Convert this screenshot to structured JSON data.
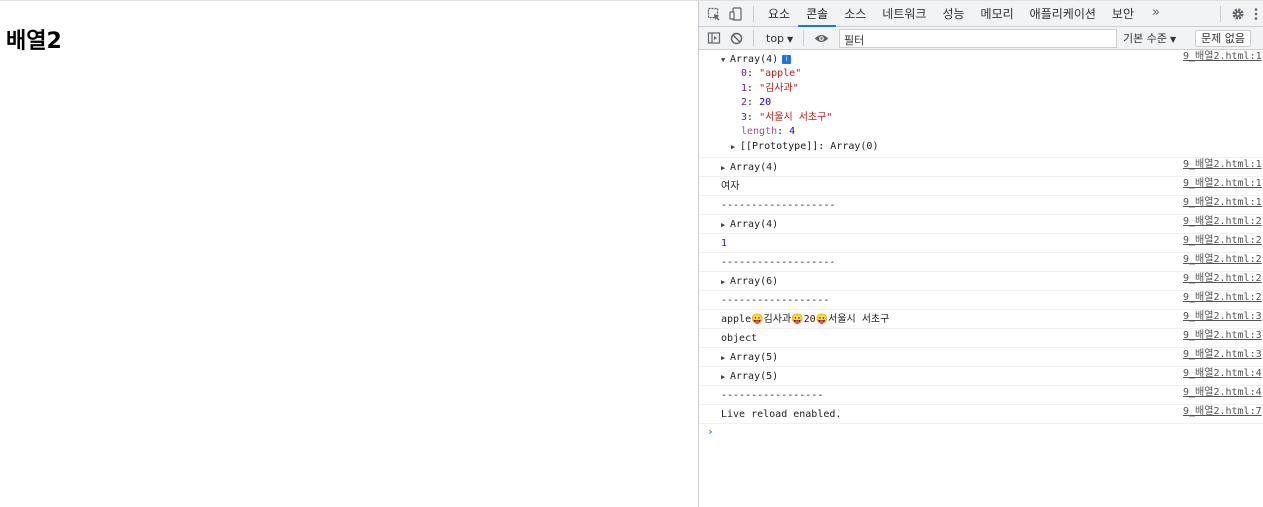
{
  "page": {
    "heading": "배열2"
  },
  "devtools": {
    "tabs": [
      "요소",
      "콘솔",
      "소스",
      "네트워크",
      "성능",
      "메모리",
      "애플리케이션",
      "보안"
    ],
    "active_tab": "콘솔",
    "more_tabs": "»",
    "toolbar": {
      "context": "top",
      "filter_placeholder": "필터",
      "level": "기본 수준",
      "issues": "문제 없음"
    },
    "expanded_array": {
      "header": "Array(4)",
      "items": [
        {
          "key": "0",
          "value": "\"apple\"",
          "kind": "str"
        },
        {
          "key": "1",
          "value": "\"김사과\"",
          "kind": "str"
        },
        {
          "key": "2",
          "value": "20",
          "kind": "num"
        },
        {
          "key": "3",
          "value": "\"서울시 서초구\"",
          "kind": "str"
        }
      ],
      "length_key": "length",
      "length_value": "4",
      "prototype": "[[Prototype]]: Array(0)",
      "source": "9_배열2.html:1"
    },
    "logs": [
      {
        "text": "Array(4)",
        "expandable": true,
        "source": "9_배열2.html:1"
      },
      {
        "text": "여자",
        "expandable": false,
        "source": "9_배열2.html:1"
      },
      {
        "text": "-------------------",
        "expandable": false,
        "source": "9_배열2.html:1"
      },
      {
        "text": "Array(4)",
        "expandable": true,
        "source": "9_배열2.html:2"
      },
      {
        "text": "1",
        "expandable": false,
        "number": true,
        "source": "9_배열2.html:2"
      },
      {
        "text": "-------------------",
        "expandable": false,
        "source": "9_배열2.html:2"
      },
      {
        "text": "Array(6)",
        "expandable": true,
        "source": "9_배열2.html:2"
      },
      {
        "text": "------------------",
        "expandable": false,
        "source": "9_배열2.html:2"
      },
      {
        "text": "apple😛김사과😛20😛서울시 서초구",
        "expandable": false,
        "source": "9_배열2.html:3"
      },
      {
        "text": "object",
        "expandable": false,
        "source": "9_배열2.html:3"
      },
      {
        "text": "Array(5)",
        "expandable": true,
        "source": "9_배열2.html:3"
      },
      {
        "text": "Array(5)",
        "expandable": true,
        "source": "9_배열2.html:4"
      },
      {
        "text": "-----------------",
        "expandable": false,
        "source": "9_배열2.html:4"
      },
      {
        "text": "Live reload enabled.",
        "expandable": false,
        "source": "9_배열2.html:7"
      }
    ],
    "prompt": "›",
    "colors": {
      "accent": "#1a73e8",
      "string": "#c41a16",
      "number": "#1c00cf",
      "key": "#881280"
    }
  }
}
